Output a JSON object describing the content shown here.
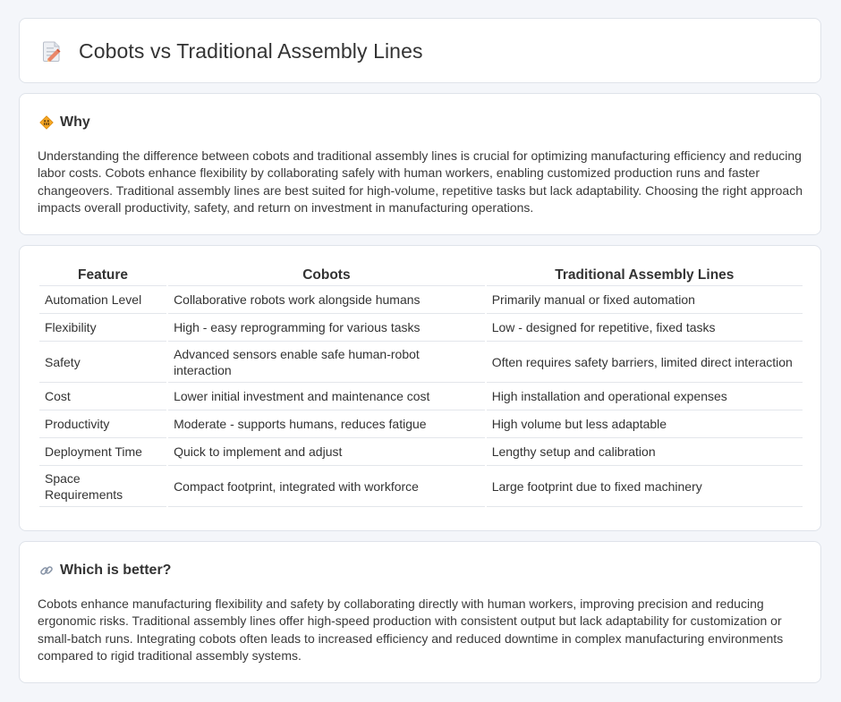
{
  "header": {
    "title": "Cobots vs Traditional Assembly Lines",
    "icon": "document-edit-icon"
  },
  "why": {
    "heading": "Why",
    "icon": "road-sign-icon",
    "text": "Understanding the difference between cobots and traditional assembly lines is crucial for optimizing manufacturing efficiency and reducing labor costs. Cobots enhance flexibility by collaborating safely with human workers, enabling customized production runs and faster changeovers. Traditional assembly lines are best suited for high-volume, repetitive tasks but lack adaptability. Choosing the right approach impacts overall productivity, safety, and return on investment in manufacturing operations."
  },
  "table": {
    "headers": [
      "Feature",
      "Cobots",
      "Traditional Assembly Lines"
    ],
    "rows": [
      [
        "Automation Level",
        "Collaborative robots work alongside humans",
        "Primarily manual or fixed automation"
      ],
      [
        "Flexibility",
        "High - easy reprogramming for various tasks",
        "Low - designed for repetitive, fixed tasks"
      ],
      [
        "Safety",
        "Advanced sensors enable safe human-robot interaction",
        "Often requires safety barriers, limited direct interaction"
      ],
      [
        "Cost",
        "Lower initial investment and maintenance cost",
        "High installation and operational expenses"
      ],
      [
        "Productivity",
        "Moderate - supports humans, reduces fatigue",
        "High volume but less adaptable"
      ],
      [
        "Deployment Time",
        "Quick to implement and adjust",
        "Lengthy setup and calibration"
      ],
      [
        "Space Requirements",
        "Compact footprint, integrated with workforce",
        "Large footprint due to fixed machinery"
      ]
    ]
  },
  "better": {
    "heading": "Which is better?",
    "icon": "link-icon",
    "text": "Cobots enhance manufacturing flexibility and safety by collaborating directly with human workers, improving precision and reducing ergonomic risks. Traditional assembly lines offer high-speed production with consistent output but lack adaptability for customization or small-batch runs. Integrating cobots often leads to increased efficiency and reduced downtime in complex manufacturing environments compared to rigid traditional assembly systems."
  }
}
